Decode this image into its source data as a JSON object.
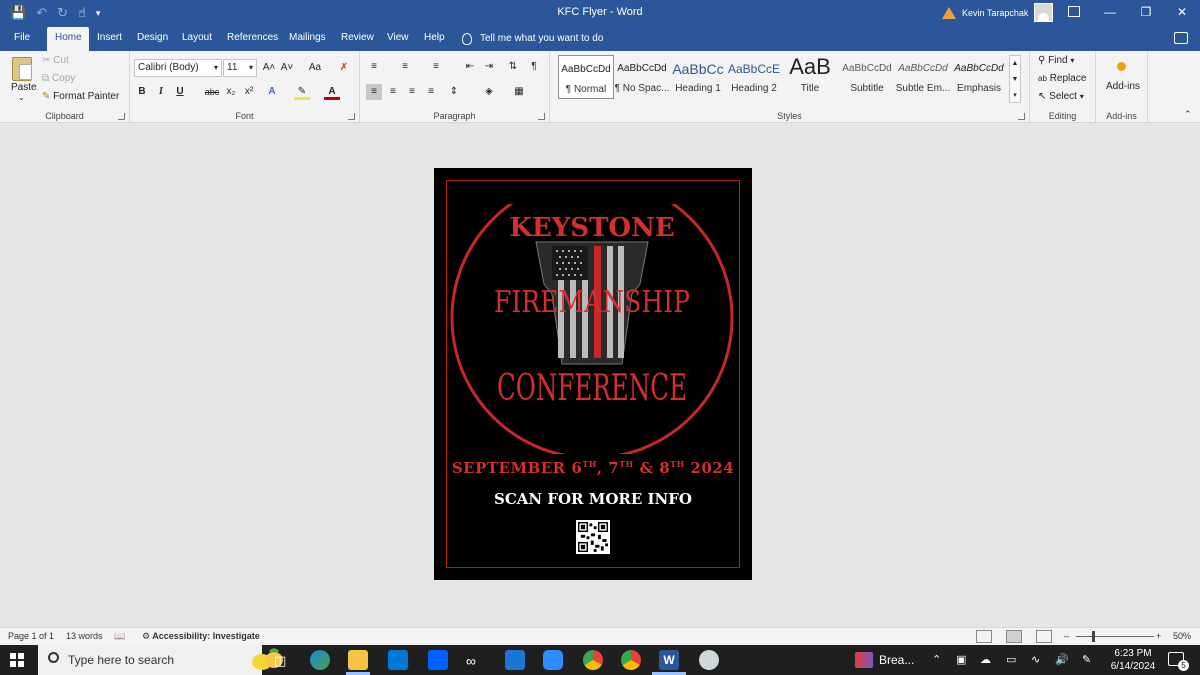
{
  "titlebar": {
    "doc_title": "KFC Flyer  -  Word",
    "user_name": "Kevin Tarapchak"
  },
  "tabs": [
    {
      "label": "File"
    },
    {
      "label": "Home"
    },
    {
      "label": "Insert"
    },
    {
      "label": "Design"
    },
    {
      "label": "Layout"
    },
    {
      "label": "References"
    },
    {
      "label": "Mailings"
    },
    {
      "label": "Review"
    },
    {
      "label": "View"
    },
    {
      "label": "Help"
    }
  ],
  "tell_me": "Tell me what you want to do",
  "clipboard": {
    "paste": "Paste",
    "cut": "Cut",
    "copy": "Copy",
    "format_painter": "Format Painter",
    "label": "Clipboard"
  },
  "font": {
    "family": "Calibri (Body)",
    "size": "11",
    "label": "Font",
    "grow": "A˄",
    "shrink": "A˅",
    "case": "Aa",
    "bold": "B",
    "italic": "I",
    "underline": "U",
    "strike": "abc",
    "subscript": "x₂",
    "superscript": "x²"
  },
  "paragraph": {
    "label": "Paragraph",
    "pilcrow": "¶"
  },
  "styles": {
    "label": "Styles",
    "items": [
      {
        "sample": "AaBbCcDd",
        "name": "¶ Normal"
      },
      {
        "sample": "AaBbCcDd",
        "name": "¶ No Spac..."
      },
      {
        "sample": "AaBbCc",
        "name": "Heading 1"
      },
      {
        "sample": "AaBbCcE",
        "name": "Heading 2"
      },
      {
        "sample": "AaB",
        "name": "Title"
      },
      {
        "sample": "AaBbCcDd",
        "name": "Subtitle"
      },
      {
        "sample": "AaBbCcDd",
        "name": "Subtle Em..."
      },
      {
        "sample": "AaBbCcDd",
        "name": "Emphasis"
      }
    ]
  },
  "editing": {
    "find": "Find",
    "replace": "Replace",
    "select": "Select",
    "label": "Editing"
  },
  "addins": {
    "button": "Add-ins",
    "label": "Add-ins"
  },
  "flyer": {
    "line1": "KEYSTONE",
    "line2": "FIREMANSHIP",
    "line3": "CONFERENCE",
    "date_parts": [
      "SEPTEMBER 6",
      "TH",
      ", 7",
      "TH",
      " & 8",
      "TH",
      " 2024"
    ],
    "scan": "SCAN FOR MORE INFO"
  },
  "status": {
    "page": "Page 1 of 1",
    "words": "13 words",
    "accessibility": "Accessibility: Investigate",
    "zoom": "50%"
  },
  "taskbar": {
    "search_placeholder": "Type here to search",
    "active_app": "Brea...",
    "time": "6:23 PM",
    "date": "6/14/2024",
    "notifications": "5"
  },
  "colors": {
    "word_blue": "#2b579a",
    "flyer_red": "#d32f2f",
    "flyer_bg": "#000000"
  }
}
